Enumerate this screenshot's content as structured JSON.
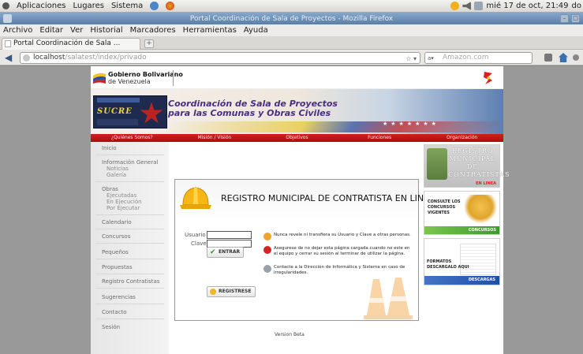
{
  "system_panel": {
    "menus": [
      "Aplicaciones",
      "Lugares",
      "Sistema"
    ],
    "clock": "mié 17 de oct, 21:49",
    "user": "do"
  },
  "window": {
    "title": "Portal Coordinación de Sala de Proyectos - Mozilla Firefox"
  },
  "menubar": [
    "Archivo",
    "Editar",
    "Ver",
    "Historial",
    "Marcadores",
    "Herramientas",
    "Ayuda"
  ],
  "tabs": [
    {
      "label": "Portal Coordinación de Sala ..."
    }
  ],
  "navbar": {
    "url_host": "localhost",
    "url_path": "/salatest/index/privado",
    "search_placeholder": "Amazon.com"
  },
  "page": {
    "header": {
      "gov_line1": "Gobierno Bolivariano",
      "gov_line2": "de Venezuela"
    },
    "banner": {
      "title_line1": "Coordinación de Sala de Proyectos",
      "title_line2": "para las Comunas y Obras Civiles",
      "sucre_label": "SUCRE"
    },
    "topnav": [
      "¿Quiénes Somos?",
      "Misión / Visión",
      "Objetivos",
      "Funciones",
      "Organización"
    ],
    "sidebar": {
      "inicio": "Inicio",
      "info_general": "Información General",
      "info_sub": [
        "Noticias",
        "Galería"
      ],
      "obras": "Obras",
      "obras_sub": [
        "Ejecutadas",
        "En Ejecución",
        "Por Ejecutar"
      ],
      "items": [
        "Calendario",
        "Concursos",
        "Pequeños",
        "Propuestas",
        "Registro Contratistas",
        "Sugerencias",
        "Contacto",
        "Sesión"
      ]
    },
    "registro": {
      "title": "REGISTRO  MUNICIPAL DE CONTRATISTA EN LINEA",
      "usuario_label": "Usuario",
      "clave_label": "Clave",
      "entrar_label": "ENTRAR",
      "registrese_label": "REGISTRESE",
      "notices": [
        "Nunca revele ni transfiera su Usuario y Clave a otras personas.",
        "Asegurese de no dejar esta página cargada cuando no este en el equipo y cerrar su sesión al terminar de utilizar la página.",
        "Contacte a la Dirección de Informática y Sistema en caso de irregularidades."
      ]
    },
    "footer_note": "Version Beta",
    "right_promos": {
      "registro_line1": "REGISTRO",
      "registro_line2": "MUNICIPAL",
      "registro_line3": "DE",
      "registro_line4": "CONTRATISTAS",
      "registro_tag": "EN LINEA",
      "concursos_text_1": "CONSULTE LOS",
      "concursos_text_2": "CONCURSOS",
      "concursos_text_3": "VIGENTES",
      "concursos_bar": "CONCURSOS",
      "formatos_text_1": "FORMATOS",
      "formatos_text_2": "DESCARGALO AQUI",
      "descargas_bar": "DESCARGAS"
    }
  },
  "colors": {
    "nav_red": "#c41515",
    "title_purple": "#4a2d84",
    "titlebar_blue": "#6f91b8"
  }
}
